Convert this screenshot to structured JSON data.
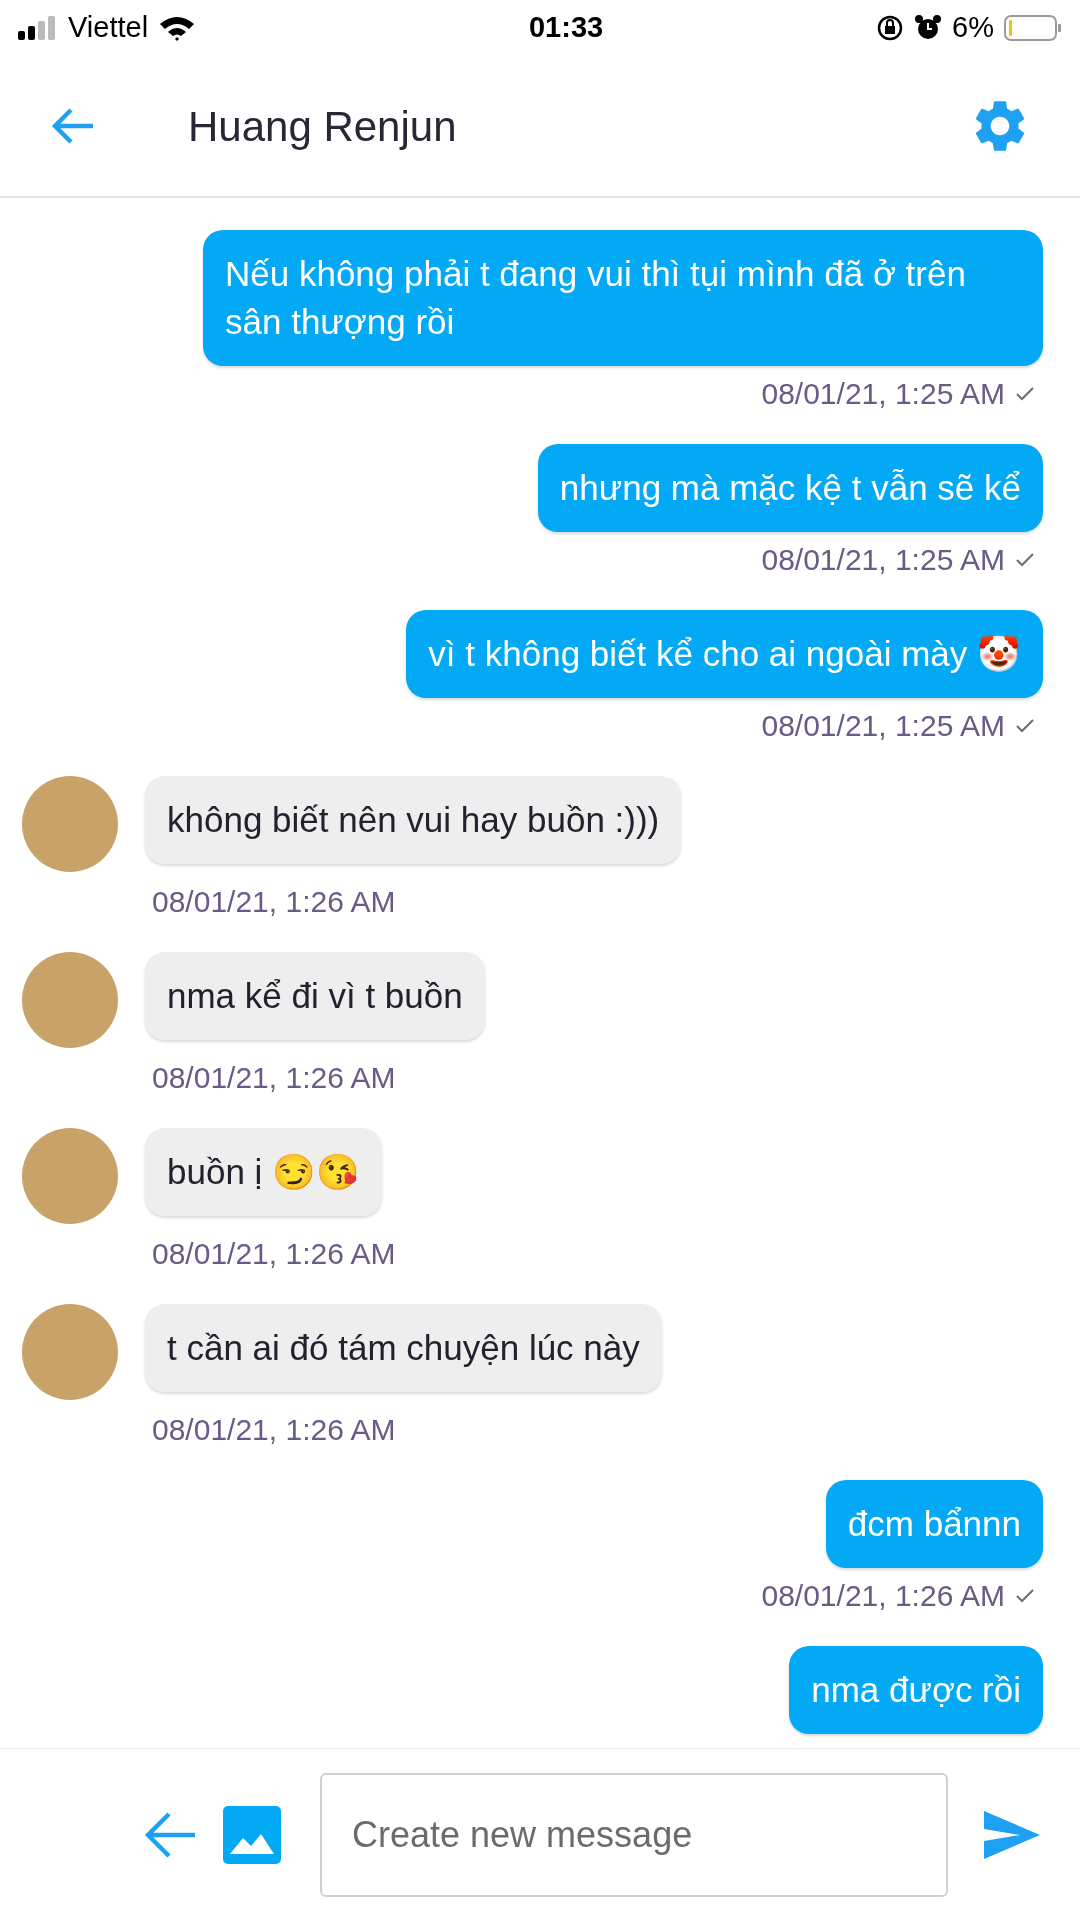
{
  "status_bar": {
    "carrier": "Viettel",
    "time": "01:33",
    "battery": "6%"
  },
  "header": {
    "title": "Huang Renjun"
  },
  "messages": [
    {
      "kind": "sent",
      "text": "Nếu không phải t đang vui thì tụi mình đã ở trên sân thượng rồi",
      "timestamp": "08/01/21, 1:25 AM",
      "delivered": true
    },
    {
      "kind": "sent",
      "text": "nhưng mà mặc kệ t vẫn sẽ kể",
      "timestamp": "08/01/21, 1:25 AM",
      "delivered": true
    },
    {
      "kind": "sent",
      "text": "vì t không biết kể cho ai ngoài mày 🤡",
      "timestamp": "08/01/21, 1:25 AM",
      "delivered": true
    },
    {
      "kind": "received",
      "text": "không biết nên vui hay buồn :)))",
      "timestamp": "08/01/21, 1:26 AM"
    },
    {
      "kind": "received",
      "text": "nma kể đi vì t buồn",
      "timestamp": "08/01/21, 1:26 AM"
    },
    {
      "kind": "received",
      "text": "buồn ị 😏😘",
      "timestamp": "08/01/21, 1:26 AM"
    },
    {
      "kind": "received",
      "text": "t cần ai đó tám chuyện lúc này",
      "timestamp": "08/01/21, 1:26 AM"
    },
    {
      "kind": "sent",
      "text": "đcm bẩnnn",
      "timestamp": "08/01/21, 1:26 AM",
      "delivered": true
    },
    {
      "kind": "sent",
      "text": "nma được rồi"
    }
  ],
  "composer": {
    "placeholder": "Create new message"
  }
}
